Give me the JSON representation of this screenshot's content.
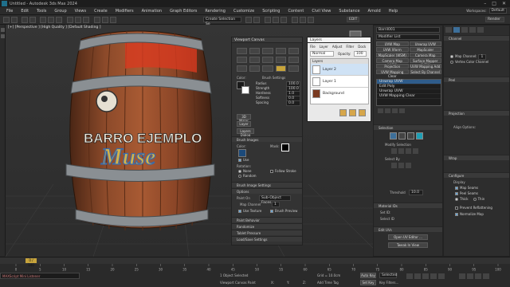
{
  "title": "Untitled - Autodesk 3ds Max 2024",
  "window_controls": [
    "–",
    "□",
    "✕"
  ],
  "menu": [
    "File",
    "Edit",
    "Tools",
    "Group",
    "Views",
    "Create",
    "Modifiers",
    "Animation",
    "Graph Editors",
    "Rendering",
    "Customize",
    "Scripting",
    "Content",
    "Civil View",
    "Substance",
    "Arnold",
    "Help"
  ],
  "workspace": {
    "user": "Workspaces:",
    "value": "Default"
  },
  "toolbar": {
    "selection_set": "Create Selection Se",
    "edit": "EDIT",
    "render": "Render"
  },
  "viewport": {
    "label": "[+] [Perspective ] [High Quality ] [Default Shading ]",
    "barrel_text_top": "BARRO EJEMPLO",
    "barrel_text_bottom": "Muse"
  },
  "viewport_canvas": {
    "title": "Viewport Canvas",
    "brush_settings": "Brush Settings",
    "color_label": "Color:",
    "fields": [
      "Radius",
      "Strength",
      "Hardness",
      "Softness",
      "Spacing"
    ],
    "values": [
      "100.0",
      "100.0",
      "1.0",
      "0.0",
      "0.0"
    ],
    "buttons": [
      "3D Mirror",
      "Layer",
      "Layers Dialog"
    ],
    "brush_images": "Brush Images",
    "color": "Color:",
    "use": "Use",
    "mask": "Mask:",
    "rotation": "Rotation:",
    "rot_opts": [
      "None",
      "Random"
    ],
    "follow": "Follow Stroke",
    "brush_image_settings": "Brush Image Settings",
    "options": "Options",
    "paint_on": "Paint On",
    "paint_on_value": "Sub-Object Faces",
    "map_channel": "Map Channel",
    "map_channel_value": "1",
    "use_texture": "Use Texture",
    "brush_preview": "Brush Preview",
    "rollouts": [
      "Paint Behavior",
      "Randomize",
      "Tablet Pressure",
      "Load/Save Settings"
    ]
  },
  "layers": {
    "title": "Layers",
    "menu": [
      "File",
      "Layer",
      "Adjust",
      "Filter",
      "Dock"
    ],
    "mode": "Normal",
    "opacity_label": "Opacity:",
    "opacity": "100",
    "header": "Layers",
    "items": [
      "Layer 2",
      "Layer 1",
      "Background"
    ]
  },
  "command_panel": {
    "object": "Barril001",
    "modifier_list": "Modifier List",
    "buttons": [
      "UVW Map",
      "Unwrap UVW",
      "UVW Xform",
      "MapScaler",
      "MapScaler (WSM)",
      "Camera Map",
      "Camera Map (WSM)",
      "Surface Mapper (WSM)",
      "Projection",
      "UVW Mapping Add",
      "UVW Mapping Clear",
      "Select By Channel"
    ],
    "stack": [
      "Unwrap UVW",
      "Edit Poly",
      "Unwrap UVW",
      "UVW Mapping Clear"
    ],
    "selection": "Selection",
    "modify_selection": "Modify Selection",
    "select_by": "Select By",
    "threshold_label": "Threshold",
    "threshold": "10.0",
    "material_ids": "Material IDs",
    "set_id": "Set ID:",
    "select_id": "Select ID",
    "edit_uvs": "Edit UVs",
    "open_editor": "Open UV Editor ...",
    "tweak": "Tweak In View"
  },
  "right_panel": {
    "channel": "Channel",
    "channel_opts": [
      "Map Channel:",
      "Vertex Color Channel"
    ],
    "map_channel": "1",
    "peel": "Peel",
    "projection": "Projection",
    "align_options": "Align Options:",
    "wrap": "Wrap",
    "configure": "Configure",
    "display": "Display",
    "configure_opts": [
      "Map Seams",
      "Peel Seams",
      "Thick",
      "Thin"
    ],
    "prevent": "Prevent Reflattening",
    "normalize": "Normalize Map"
  },
  "timeline": {
    "frame": "0 / 100",
    "ticks": [
      "0",
      "5",
      "10",
      "15",
      "20",
      "25",
      "30",
      "35",
      "40",
      "45",
      "50",
      "55",
      "60",
      "65",
      "70",
      "75",
      "80",
      "85",
      "90",
      "95",
      "100"
    ]
  },
  "status": {
    "listener": "MAXScript Mini Listener",
    "objects": "1 Object Selected",
    "prompt": "Viewport Canvas Paint",
    "x": "X:",
    "y": "Y:",
    "z": "Z:",
    "grid": "Grid = 10.0cm",
    "autokey": "Auto Key",
    "selected": "Selected",
    "setkey": "Set Key",
    "filters": "Key Filters...",
    "time": "Add Time Tag"
  }
}
